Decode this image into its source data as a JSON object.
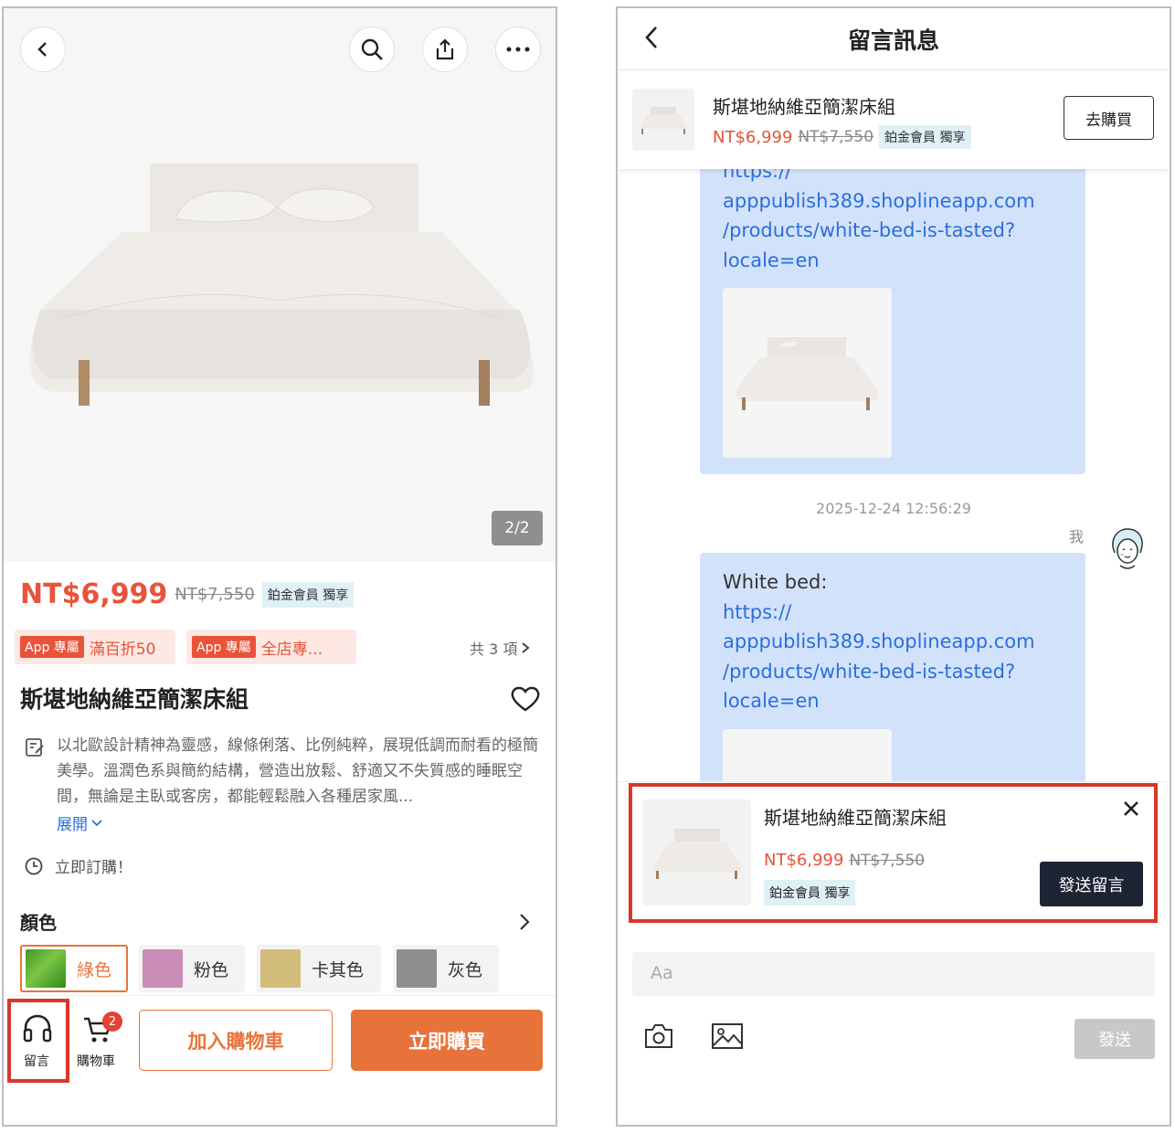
{
  "left": {
    "image_counter": "2/2",
    "price": "NT$6,999",
    "original_price": "NT$7,550",
    "member_tag": "鉑金會員 獨享",
    "promos": [
      {
        "app": "App 專屬",
        "text": "滿百折50"
      },
      {
        "app": "App 專屬",
        "text": "全店專..."
      }
    ],
    "promo_count": "共 3 項",
    "title": "斯堪地納維亞簡潔床組",
    "description": "以北歐設計精神為靈感，線條俐落、比例純粹，展現低調而耐看的極簡美學。溫潤色系與簡約結構，營造出放鬆、舒適又不失質感的睡眠空間，無論是主臥或客房，都能輕鬆融入各種居家風...",
    "expand": "展開",
    "order_text": "立即訂購！",
    "color_heading": "顏色",
    "colors": [
      {
        "label": "綠色",
        "color": "#4caf30"
      },
      {
        "label": "粉色",
        "color": "#c98db7"
      },
      {
        "label": "卡其色",
        "color": "#d3bd7a"
      },
      {
        "label": "灰色",
        "color": "#8e8e8e"
      }
    ],
    "bottom": {
      "message_label": "留言",
      "cart_label": "購物車",
      "cart_badge": "2",
      "add_to_cart": "加入購物車",
      "buy_now": "立即購買"
    }
  },
  "right": {
    "title": "留言訊息",
    "product": {
      "name": "斯堪地納維亞簡潔床組",
      "price": "NT$6,999",
      "original_price": "NT$7,550",
      "member_tag": "鉑金會員 獨享",
      "go_buy": "去購買"
    },
    "messages": [
      {
        "lines": [
          "https://",
          "apppublish389.shoplineapp.com",
          "/products/white-bed-is-tasted?",
          "locale=en"
        ]
      },
      {
        "prefix": "White bed:",
        "lines": [
          "https://",
          "apppublish389.shoplineapp.com",
          "/products/white-bed-is-tasted?",
          "locale=en"
        ]
      }
    ],
    "timestamp": "2025-12-24 12:56:29",
    "me_label": "我",
    "popup": {
      "name": "斯堪地納維亞簡潔床組",
      "price": "NT$6,999",
      "original_price": "NT$7,550",
      "member_tag": "鉑金會員 獨享",
      "send": "發送留言"
    },
    "input_placeholder": "Aa",
    "send": "發送"
  },
  "colors": {
    "accent": "#e8733a",
    "price": "#e8533a",
    "highlight": "#d9372a",
    "bubble": "#d3e2fb",
    "link": "#2a6fdb"
  }
}
